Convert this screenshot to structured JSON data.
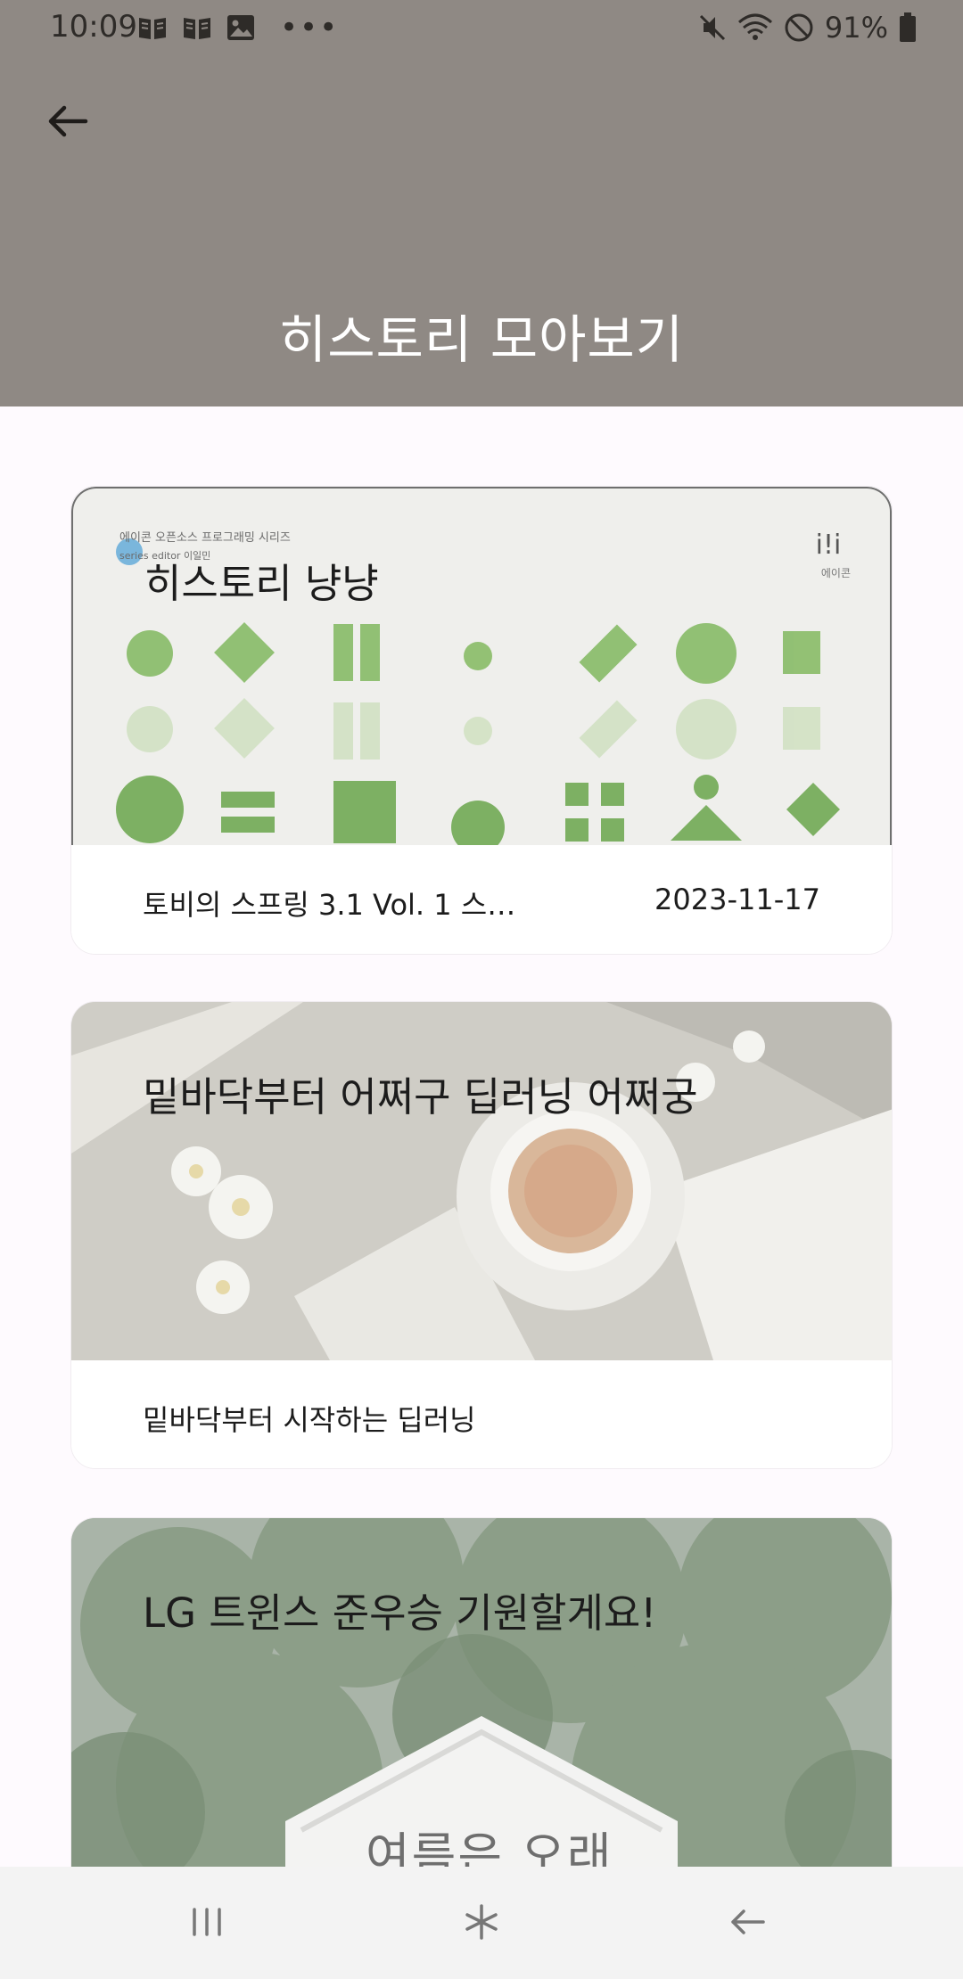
{
  "status_bar": {
    "time": "10:09",
    "battery_text": "91%",
    "left_icons": [
      "book-icon",
      "book-icon",
      "image-icon",
      "more-icon"
    ],
    "right_icons": [
      "mute-icon",
      "wifi-icon",
      "dnd-icon",
      "battery-icon"
    ]
  },
  "header": {
    "title": "히스토리 모아보기",
    "background": "#8F8984",
    "back_icon": "arrow-left-icon"
  },
  "cards": [
    {
      "title": "히스토리 냥냥",
      "subtitle": "토비의 스프링 3.1 Vol. 1 스…",
      "date": "2023-11-17",
      "cover_series": "에이콘 오픈소스 프로그래밍 시리즈",
      "cover_editor": "series editor 이일민",
      "cover_logo": "i!i",
      "cover_logo_sub": "에이콘"
    },
    {
      "title": "밑바닥부터 어쩌구 딥러닝 어쩌궁",
      "subtitle": "밑바닥부터 시작하는 딥러닝"
    },
    {
      "title": "LG 트윈스 준우승 기원할게요!",
      "image_text": "여름은 오래"
    }
  ],
  "nav": {
    "recents_icon": "recents-icon",
    "home_icon": "home-icon",
    "back_icon": "back-icon"
  }
}
